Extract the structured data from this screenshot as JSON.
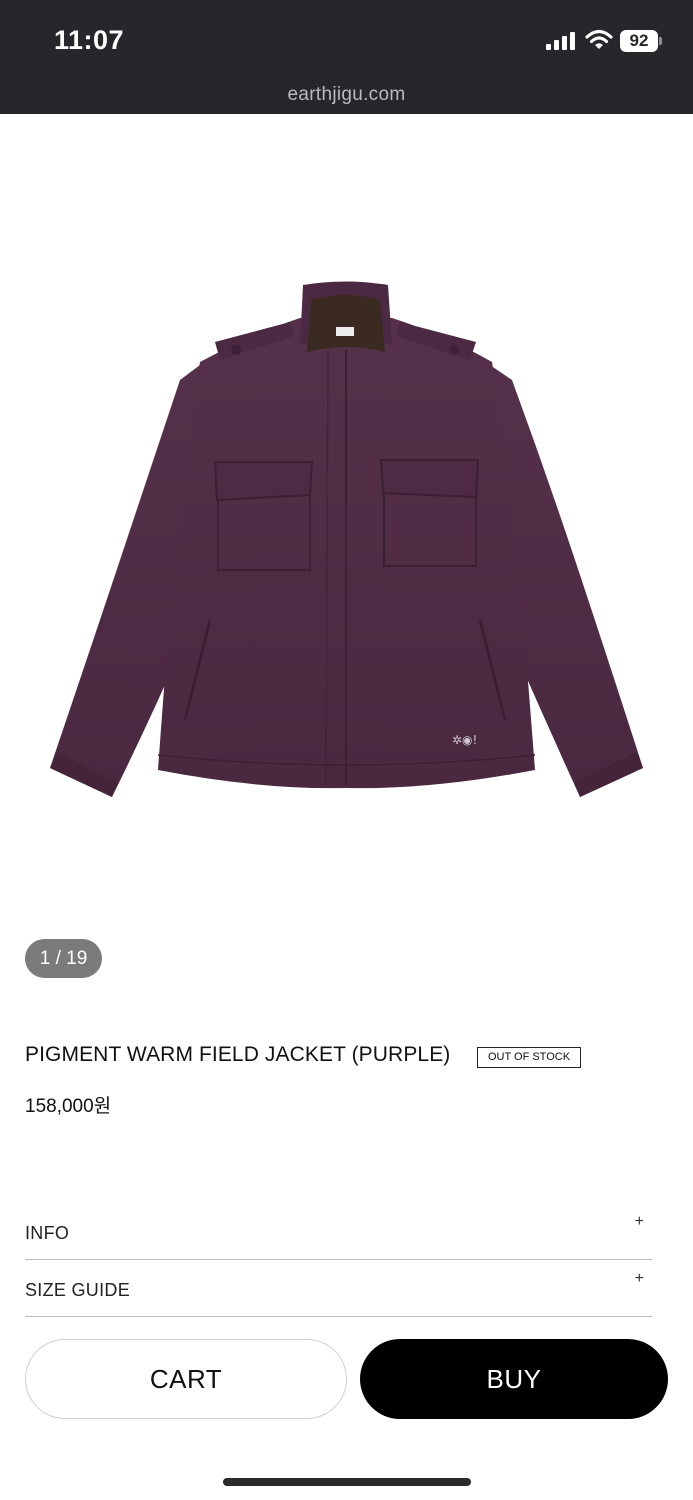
{
  "status_bar": {
    "time": "11:07",
    "battery": "92",
    "url": "earthjigu.com"
  },
  "gallery": {
    "counter": "1 / 19",
    "image_description_icon": "purple-field-jacket-photo"
  },
  "product": {
    "title": "PIGMENT WARM FIELD JACKET (PURPLE)",
    "badge": "OUT OF STOCK",
    "price": "158,000원"
  },
  "accordions": [
    {
      "label": "INFO",
      "icon": "+"
    },
    {
      "label": "SIZE GUIDE",
      "icon": "+"
    }
  ],
  "actions": {
    "cart_label": "CART",
    "buy_label": "BUY"
  },
  "colors": {
    "status_bar_bg": "#25272a",
    "jacket_purple": "#4f2a44",
    "buy_button_bg": "#000000",
    "counter_bg": "#7b7b7b"
  }
}
